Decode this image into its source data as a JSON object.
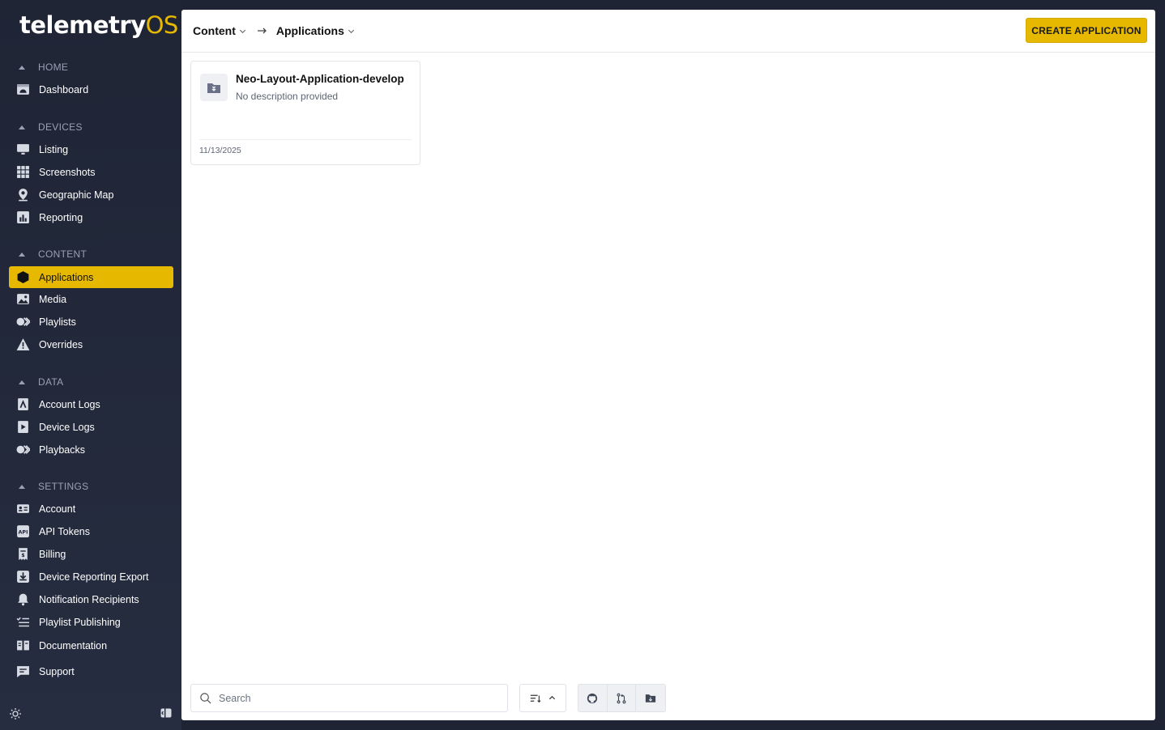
{
  "brand": {
    "name_main": "telemetry",
    "name_accent": "OS",
    "accent_color": "#e6b800"
  },
  "sidebar": {
    "sections": [
      {
        "label": "HOME",
        "items": [
          {
            "label": "Dashboard",
            "icon": "dashboard-icon"
          }
        ]
      },
      {
        "label": "DEVICES",
        "items": [
          {
            "label": "Listing",
            "icon": "monitor-icon"
          },
          {
            "label": "Screenshots",
            "icon": "grid-icon"
          },
          {
            "label": "Geographic Map",
            "icon": "map-pin-icon"
          },
          {
            "label": "Reporting",
            "icon": "bar-chart-icon"
          }
        ]
      },
      {
        "label": "CONTENT",
        "items": [
          {
            "label": "Applications",
            "icon": "cube-icon",
            "active": true
          },
          {
            "label": "Media",
            "icon": "image-icon"
          },
          {
            "label": "Playlists",
            "icon": "playlist-icon"
          },
          {
            "label": "Overrides",
            "icon": "warning-icon"
          }
        ]
      },
      {
        "label": "DATA",
        "items": [
          {
            "label": "Account Logs",
            "icon": "account-log-icon"
          },
          {
            "label": "Device Logs",
            "icon": "device-log-icon"
          },
          {
            "label": "Playbacks",
            "icon": "playback-icon"
          }
        ]
      },
      {
        "label": "SETTINGS",
        "items": [
          {
            "label": "Account",
            "icon": "id-card-icon"
          },
          {
            "label": "API Tokens",
            "icon": "api-icon"
          },
          {
            "label": "Billing",
            "icon": "receipt-icon"
          },
          {
            "label": "Device Reporting Export",
            "icon": "download-icon"
          },
          {
            "label": "Notification Recipients",
            "icon": "bell-icon"
          },
          {
            "label": "Playlist Publishing",
            "icon": "list-check-icon"
          }
        ]
      }
    ],
    "footer_links": [
      {
        "label": "Documentation",
        "icon": "book-icon"
      },
      {
        "label": "Support",
        "icon": "chat-icon"
      }
    ]
  },
  "header": {
    "breadcrumb": [
      "Content",
      "Applications"
    ],
    "create_button": "CREATE APPLICATION"
  },
  "applications": [
    {
      "name": "Neo-Layout-Application-develop",
      "description": "No description provided",
      "date": "11/13/2025",
      "icon": "app-folder-icon"
    }
  ],
  "toolbar": {
    "search_placeholder": "Search",
    "sort_icon": "sort-icon",
    "filters": [
      "github-icon",
      "git-pull-icon",
      "folder-upload-icon"
    ]
  }
}
